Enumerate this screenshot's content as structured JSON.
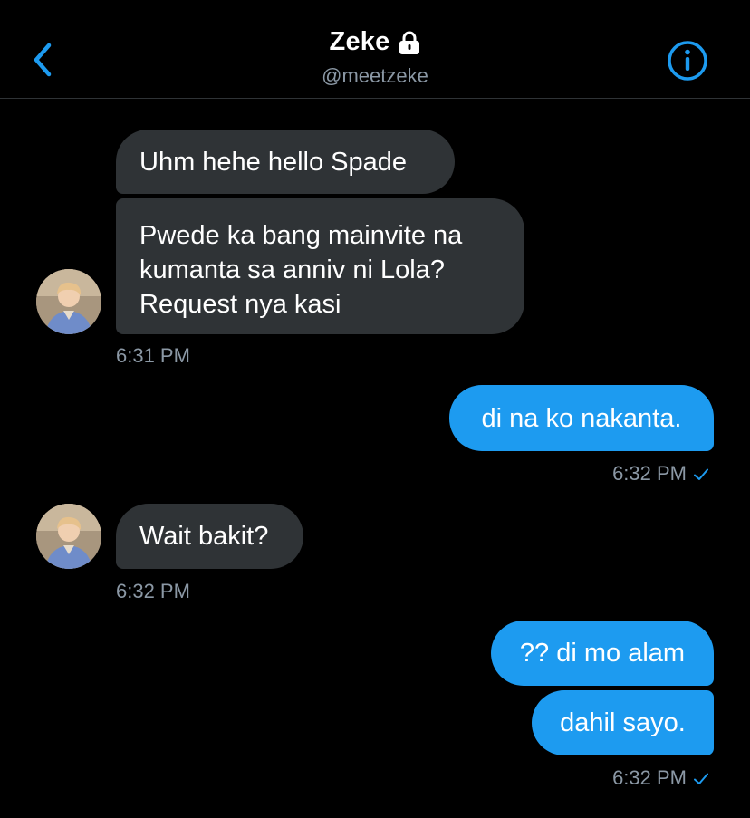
{
  "header": {
    "name": "Zeke",
    "handle": "@meetzeke",
    "back_icon": "chevron-left-icon",
    "info_icon": "info-icon",
    "lock_icon": "lock-icon",
    "accent_color": "#1d9bf0"
  },
  "messages": [
    {
      "direction": "incoming",
      "lines": [
        "Uhm hehe hello Spade"
      ]
    },
    {
      "direction": "incoming",
      "lines": [
        "Pwede ka bang mainvite na",
        "kumanta sa anniv ni Lola?",
        "Request nya kasi"
      ]
    },
    {
      "direction": "outgoing",
      "lines": [
        "di na ko nakanta."
      ]
    },
    {
      "direction": "incoming",
      "lines": [
        "Wait bakit?"
      ]
    },
    {
      "direction": "outgoing",
      "lines": [
        "?? di mo alam"
      ]
    },
    {
      "direction": "outgoing",
      "lines": [
        "dahil sayo."
      ]
    }
  ],
  "timestamps": [
    "6:31 PM",
    "6:32 PM",
    "6:32 PM",
    "6:32 PM"
  ],
  "read_receipt_icon": "check-icon",
  "colors": {
    "incoming_bubble": "#2f3336",
    "outgoing_bubble": "#1d9bf0",
    "background": "#000000",
    "muted_text": "#8b98a5"
  }
}
